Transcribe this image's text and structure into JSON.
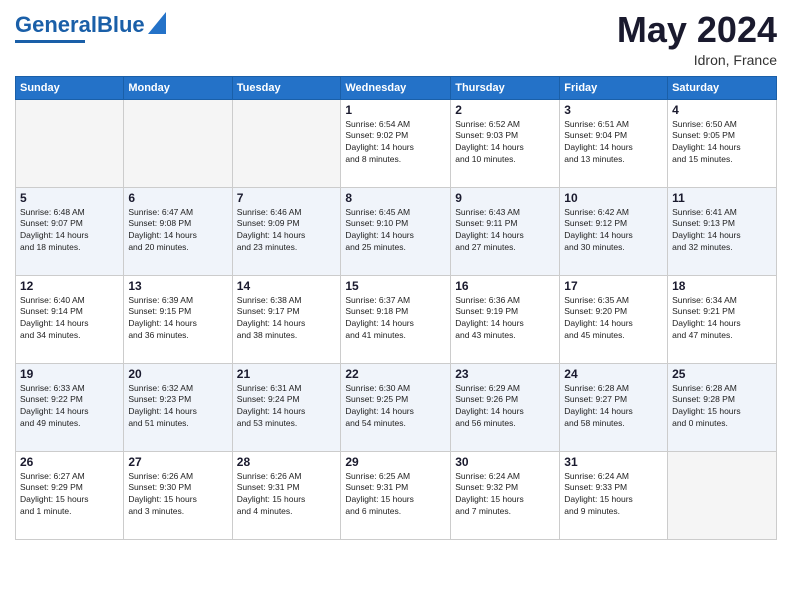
{
  "header": {
    "logo_general": "General",
    "logo_blue": "Blue",
    "month_title": "May 2024",
    "location": "Idron, France"
  },
  "days_of_week": [
    "Sunday",
    "Monday",
    "Tuesday",
    "Wednesday",
    "Thursday",
    "Friday",
    "Saturday"
  ],
  "weeks": [
    [
      {
        "day": "",
        "info": ""
      },
      {
        "day": "",
        "info": ""
      },
      {
        "day": "",
        "info": ""
      },
      {
        "day": "1",
        "info": "Sunrise: 6:54 AM\nSunset: 9:02 PM\nDaylight: 14 hours\nand 8 minutes."
      },
      {
        "day": "2",
        "info": "Sunrise: 6:52 AM\nSunset: 9:03 PM\nDaylight: 14 hours\nand 10 minutes."
      },
      {
        "day": "3",
        "info": "Sunrise: 6:51 AM\nSunset: 9:04 PM\nDaylight: 14 hours\nand 13 minutes."
      },
      {
        "day": "4",
        "info": "Sunrise: 6:50 AM\nSunset: 9:05 PM\nDaylight: 14 hours\nand 15 minutes."
      }
    ],
    [
      {
        "day": "5",
        "info": "Sunrise: 6:48 AM\nSunset: 9:07 PM\nDaylight: 14 hours\nand 18 minutes."
      },
      {
        "day": "6",
        "info": "Sunrise: 6:47 AM\nSunset: 9:08 PM\nDaylight: 14 hours\nand 20 minutes."
      },
      {
        "day": "7",
        "info": "Sunrise: 6:46 AM\nSunset: 9:09 PM\nDaylight: 14 hours\nand 23 minutes."
      },
      {
        "day": "8",
        "info": "Sunrise: 6:45 AM\nSunset: 9:10 PM\nDaylight: 14 hours\nand 25 minutes."
      },
      {
        "day": "9",
        "info": "Sunrise: 6:43 AM\nSunset: 9:11 PM\nDaylight: 14 hours\nand 27 minutes."
      },
      {
        "day": "10",
        "info": "Sunrise: 6:42 AM\nSunset: 9:12 PM\nDaylight: 14 hours\nand 30 minutes."
      },
      {
        "day": "11",
        "info": "Sunrise: 6:41 AM\nSunset: 9:13 PM\nDaylight: 14 hours\nand 32 minutes."
      }
    ],
    [
      {
        "day": "12",
        "info": "Sunrise: 6:40 AM\nSunset: 9:14 PM\nDaylight: 14 hours\nand 34 minutes."
      },
      {
        "day": "13",
        "info": "Sunrise: 6:39 AM\nSunset: 9:15 PM\nDaylight: 14 hours\nand 36 minutes."
      },
      {
        "day": "14",
        "info": "Sunrise: 6:38 AM\nSunset: 9:17 PM\nDaylight: 14 hours\nand 38 minutes."
      },
      {
        "day": "15",
        "info": "Sunrise: 6:37 AM\nSunset: 9:18 PM\nDaylight: 14 hours\nand 41 minutes."
      },
      {
        "day": "16",
        "info": "Sunrise: 6:36 AM\nSunset: 9:19 PM\nDaylight: 14 hours\nand 43 minutes."
      },
      {
        "day": "17",
        "info": "Sunrise: 6:35 AM\nSunset: 9:20 PM\nDaylight: 14 hours\nand 45 minutes."
      },
      {
        "day": "18",
        "info": "Sunrise: 6:34 AM\nSunset: 9:21 PM\nDaylight: 14 hours\nand 47 minutes."
      }
    ],
    [
      {
        "day": "19",
        "info": "Sunrise: 6:33 AM\nSunset: 9:22 PM\nDaylight: 14 hours\nand 49 minutes."
      },
      {
        "day": "20",
        "info": "Sunrise: 6:32 AM\nSunset: 9:23 PM\nDaylight: 14 hours\nand 51 minutes."
      },
      {
        "day": "21",
        "info": "Sunrise: 6:31 AM\nSunset: 9:24 PM\nDaylight: 14 hours\nand 53 minutes."
      },
      {
        "day": "22",
        "info": "Sunrise: 6:30 AM\nSunset: 9:25 PM\nDaylight: 14 hours\nand 54 minutes."
      },
      {
        "day": "23",
        "info": "Sunrise: 6:29 AM\nSunset: 9:26 PM\nDaylight: 14 hours\nand 56 minutes."
      },
      {
        "day": "24",
        "info": "Sunrise: 6:28 AM\nSunset: 9:27 PM\nDaylight: 14 hours\nand 58 minutes."
      },
      {
        "day": "25",
        "info": "Sunrise: 6:28 AM\nSunset: 9:28 PM\nDaylight: 15 hours\nand 0 minutes."
      }
    ],
    [
      {
        "day": "26",
        "info": "Sunrise: 6:27 AM\nSunset: 9:29 PM\nDaylight: 15 hours\nand 1 minute."
      },
      {
        "day": "27",
        "info": "Sunrise: 6:26 AM\nSunset: 9:30 PM\nDaylight: 15 hours\nand 3 minutes."
      },
      {
        "day": "28",
        "info": "Sunrise: 6:26 AM\nSunset: 9:31 PM\nDaylight: 15 hours\nand 4 minutes."
      },
      {
        "day": "29",
        "info": "Sunrise: 6:25 AM\nSunset: 9:31 PM\nDaylight: 15 hours\nand 6 minutes."
      },
      {
        "day": "30",
        "info": "Sunrise: 6:24 AM\nSunset: 9:32 PM\nDaylight: 15 hours\nand 7 minutes."
      },
      {
        "day": "31",
        "info": "Sunrise: 6:24 AM\nSunset: 9:33 PM\nDaylight: 15 hours\nand 9 minutes."
      },
      {
        "day": "",
        "info": ""
      }
    ]
  ]
}
